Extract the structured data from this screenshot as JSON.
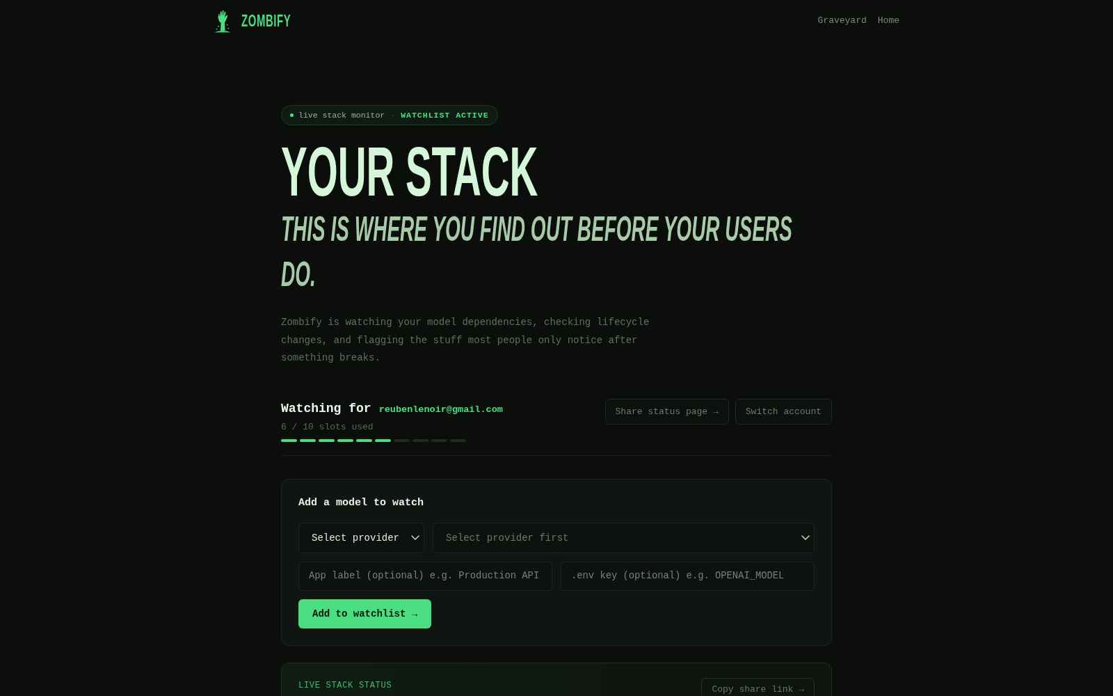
{
  "header": {
    "brand": "ZOMBIFY",
    "nav": [
      {
        "label": "Graveyard"
      },
      {
        "label": "Home"
      }
    ]
  },
  "hero": {
    "badge": {
      "label": "live stack monitor",
      "separator": "·",
      "status": "WATCHLIST ACTIVE"
    },
    "title": "YOUR STACK",
    "subtitle": "THIS IS WHERE YOU FIND OUT BEFORE YOUR USERS DO.",
    "description": "Zombify is watching your model dependencies, checking lifecycle changes, and flagging the stuff most people only notice after something breaks."
  },
  "account": {
    "heading": "Watching for",
    "email": "reubenlenoir@gmail.com",
    "usage": "6 / 10 slots used",
    "slots": [
      {
        "filled": true
      },
      {
        "filled": true
      },
      {
        "filled": true
      },
      {
        "filled": true
      },
      {
        "filled": true
      },
      {
        "filled": true
      },
      {
        "filled": false
      },
      {
        "filled": false
      },
      {
        "filled": false
      },
      {
        "filled": false
      }
    ],
    "actions": [
      "Share status page →",
      "Switch account"
    ]
  },
  "add_form": {
    "title": "Add a model to watch",
    "provider_select": {
      "value": "Select provider"
    },
    "model_select": {
      "placeholder": "Select provider first"
    },
    "app_label": {
      "placeholder": "App label (optional) e.g. Production API"
    },
    "env_key": {
      "placeholder": ".env key (optional) e.g. OPENAI_MODEL"
    },
    "submit": "Add to watchlist →"
  },
  "live_status": {
    "label": "LIVE STACK STATUS",
    "action": "Copy share link →"
  }
}
